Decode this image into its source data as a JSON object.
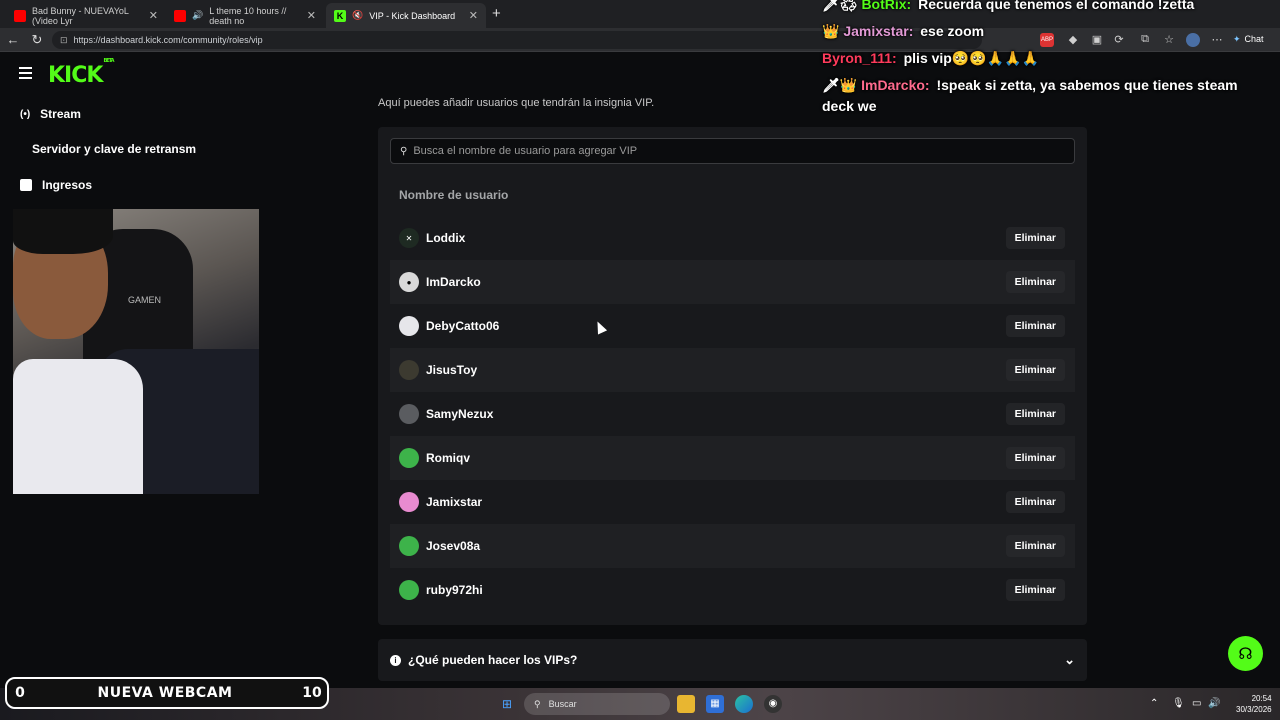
{
  "browser": {
    "tabs": [
      {
        "title": "Bad Bunny - NUEVAYoL (Video Lyr",
        "favicon_color": "#ff0000"
      },
      {
        "title": "L theme 10 hours // death no",
        "favicon_color": "#ff0000"
      },
      {
        "title": "VIP - Kick Dashboard",
        "favicon_color": "#53fc18"
      }
    ],
    "url": "https://dashboard.kick.com/community/roles/vip",
    "chat_button": "Chat"
  },
  "kick": {
    "logo": "KICK",
    "beta": "BETA",
    "sidebar": [
      {
        "label": "Stream",
        "icon": "broadcast-icon"
      },
      {
        "label": "Servidor y clave de retransm",
        "icon": ""
      },
      {
        "label": "Ingresos",
        "icon": "chart-icon"
      }
    ],
    "intro": "Aquí puedes añadir usuarios que tendrán la insignia VIP.",
    "search_placeholder": "Busca el nombre de usuario para agregar VIP",
    "column_header": "Nombre de usuario",
    "remove_label": "Eliminar",
    "users": [
      {
        "name": "Loddix",
        "avatar_color": "#1e2a22",
        "initial": "✕"
      },
      {
        "name": "ImDarcko",
        "avatar_color": "#d9d9d9",
        "initial": "●"
      },
      {
        "name": "DebyCatto06",
        "avatar_color": "#e6e6ea",
        "initial": ""
      },
      {
        "name": "JisusToy",
        "avatar_color": "#3c3a30",
        "initial": ""
      },
      {
        "name": "SamyNezux",
        "avatar_color": "#5a5c60",
        "initial": ""
      },
      {
        "name": "Romiqv",
        "avatar_color": "#3db34a",
        "initial": ""
      },
      {
        "name": "Jamixstar",
        "avatar_color": "#e88bd0",
        "initial": ""
      },
      {
        "name": "Josev08a",
        "avatar_color": "#3db34a",
        "initial": ""
      },
      {
        "name": "ruby972hi",
        "avatar_color": "#3db34a",
        "initial": ""
      }
    ],
    "faq": "¿Qué pueden hacer los VIPs?"
  },
  "chat": [
    {
      "name": "BotRix:",
      "name_color": "#53fc18",
      "text": "Recuerda que tenemos el comando !zetta",
      "badges": "🗡♻"
    },
    {
      "name": "Jamixstar:",
      "name_color": "#e39ad6",
      "text": "ese zoom",
      "badges": "👑"
    },
    {
      "name": "Byron_111:",
      "name_color": "#ff3b5c",
      "text": "plis vip🥺🥺🙏🙏🙏",
      "badges": ""
    },
    {
      "name": "ImDarcko:",
      "name_color": "#ff6b8e",
      "text": "!speak si zetta, ya sabemos que tienes steam deck we",
      "badges": "🗡👑"
    }
  ],
  "scoreboard": {
    "left": "0",
    "title": "NUEVA WEBCAM",
    "right": "10"
  },
  "webcam": {
    "brand": "GAMEN"
  },
  "taskbar": {
    "search": "Buscar",
    "time": "20:54",
    "date": "30/3/2026"
  }
}
